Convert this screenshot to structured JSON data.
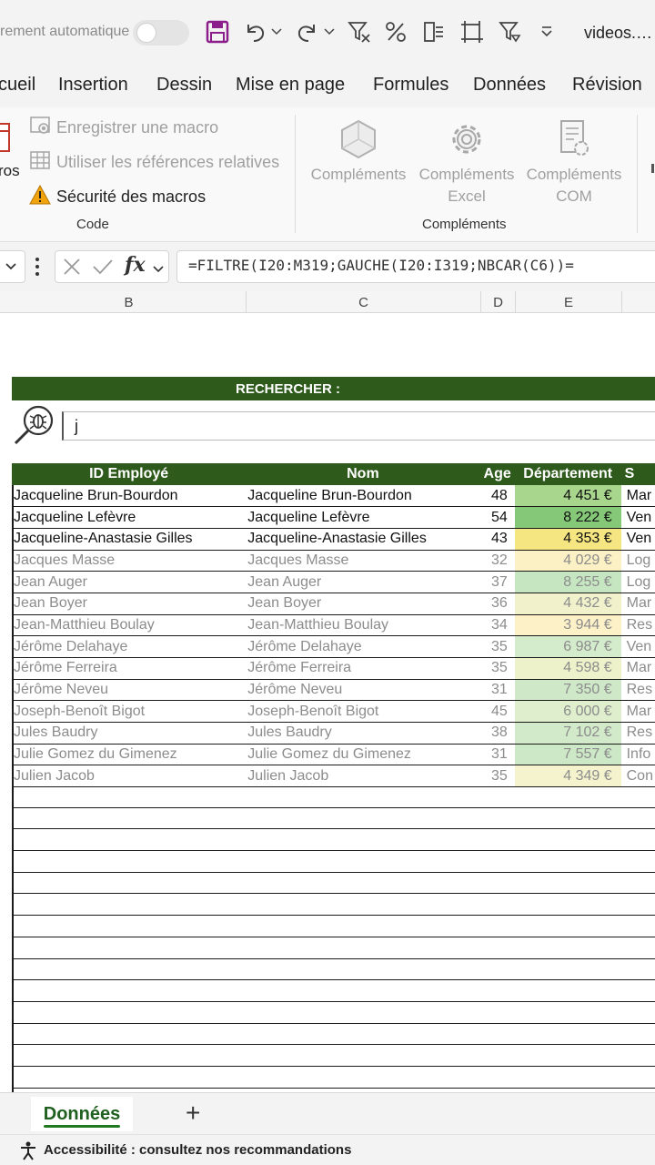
{
  "quick_access": {
    "autosave_label": "rement automatique",
    "document_title": "videos.…"
  },
  "ribbon_tabs": [
    "cueil",
    "Insertion",
    "Dessin",
    "Mise en page",
    "Formules",
    "Données",
    "Révision"
  ],
  "ribbon": {
    "macros_label": "ros",
    "record_macro": "Enregistrer une macro",
    "relative_refs": "Utiliser les références relatives",
    "macro_security": "Sécurité des macros",
    "code_group": "Code",
    "addins": "Compléments",
    "excel_addins": "Compléments Excel",
    "com_addins": "Compléments COM",
    "addins_group": "Compléments"
  },
  "formula_bar": {
    "formula": "=FILTRE(I20:M319;GAUCHE(I20:I319;NBCAR(C6))="
  },
  "column_headers": [
    "B",
    "C",
    "D",
    "E"
  ],
  "search": {
    "header": "RECHERCHER :",
    "value": "j"
  },
  "table": {
    "headers": [
      "ID Employé",
      "Nom",
      "Age",
      "Département",
      "S"
    ],
    "rows": [
      {
        "id": "Jacqueline Brun-Bourdon",
        "nom": "Jacqueline Brun-Bourdon",
        "age": "48",
        "salaire": "4 451 €",
        "dept": "Mar",
        "style": "hi",
        "color": "#a8d68c"
      },
      {
        "id": "Jacqueline Lefèvre",
        "nom": "Jacqueline Lefèvre",
        "age": "54",
        "salaire": "8 222 €",
        "dept": "Ven",
        "style": "hi",
        "color": "#84c878"
      },
      {
        "id": "Jacqueline-Anastasie Gilles",
        "nom": "Jacqueline-Anastasie Gilles",
        "age": "43",
        "salaire": "4 353 €",
        "dept": "Ven",
        "style": "hi",
        "color": "#f5e682"
      },
      {
        "id": "Jacques Masse",
        "nom": "Jacques Masse",
        "age": "32",
        "salaire": "4 029 €",
        "dept": "Log",
        "style": "dim",
        "color": "#fbf1c4"
      },
      {
        "id": "Jean Auger",
        "nom": "Jean Auger",
        "age": "37",
        "salaire": "8 255 €",
        "dept": "Log",
        "style": "dim",
        "color": "#c6e6c2"
      },
      {
        "id": "Jean Boyer",
        "nom": "Jean Boyer",
        "age": "36",
        "salaire": "4 432 €",
        "dept": "Mar",
        "style": "dim",
        "color": "#f1f2cc"
      },
      {
        "id": "Jean-Matthieu Boulay",
        "nom": "Jean-Matthieu Boulay",
        "age": "34",
        "salaire": "3 944 €",
        "dept": "Res",
        "style": "dim",
        "color": "#fdf1c8"
      },
      {
        "id": "Jérôme Delahaye",
        "nom": "Jérôme Delahaye",
        "age": "35",
        "salaire": "6 987 €",
        "dept": "Ven",
        "style": "dim",
        "color": "#d4eccb"
      },
      {
        "id": "Jérôme Ferreira",
        "nom": "Jérôme Ferreira",
        "age": "35",
        "salaire": "4 598 €",
        "dept": "Mar",
        "style": "dim",
        "color": "#eef2ca"
      },
      {
        "id": "Jérôme Neveu",
        "nom": "Jérôme Neveu",
        "age": "31",
        "salaire": "7 350 €",
        "dept": "Res",
        "style": "dim",
        "color": "#cfe9c8"
      },
      {
        "id": "Joseph-Benoît Bigot",
        "nom": "Joseph-Benoît Bigot",
        "age": "45",
        "salaire": "6 000 €",
        "dept": "Mar",
        "style": "dim",
        "color": "#dfeecc"
      },
      {
        "id": "Jules Baudry",
        "nom": "Jules Baudry",
        "age": "38",
        "salaire": "7 102 €",
        "dept": "Res",
        "style": "dim",
        "color": "#d2eac9"
      },
      {
        "id": "Julie Gomez du Gimenez",
        "nom": "Julie Gomez du Gimenez",
        "age": "31",
        "salaire": "7 557 €",
        "dept": "Info",
        "style": "dim",
        "color": "#cce8c6"
      },
      {
        "id": "Julien Jacob",
        "nom": "Julien Jacob",
        "age": "35",
        "salaire": "4 349 €",
        "dept": "Con",
        "style": "dim",
        "color": "#f4f3cd"
      }
    ]
  },
  "sheet_tabs": {
    "active": "Données",
    "add": "+"
  },
  "status": {
    "accessibility": "Accessibilité : consultez nos recommandations"
  }
}
